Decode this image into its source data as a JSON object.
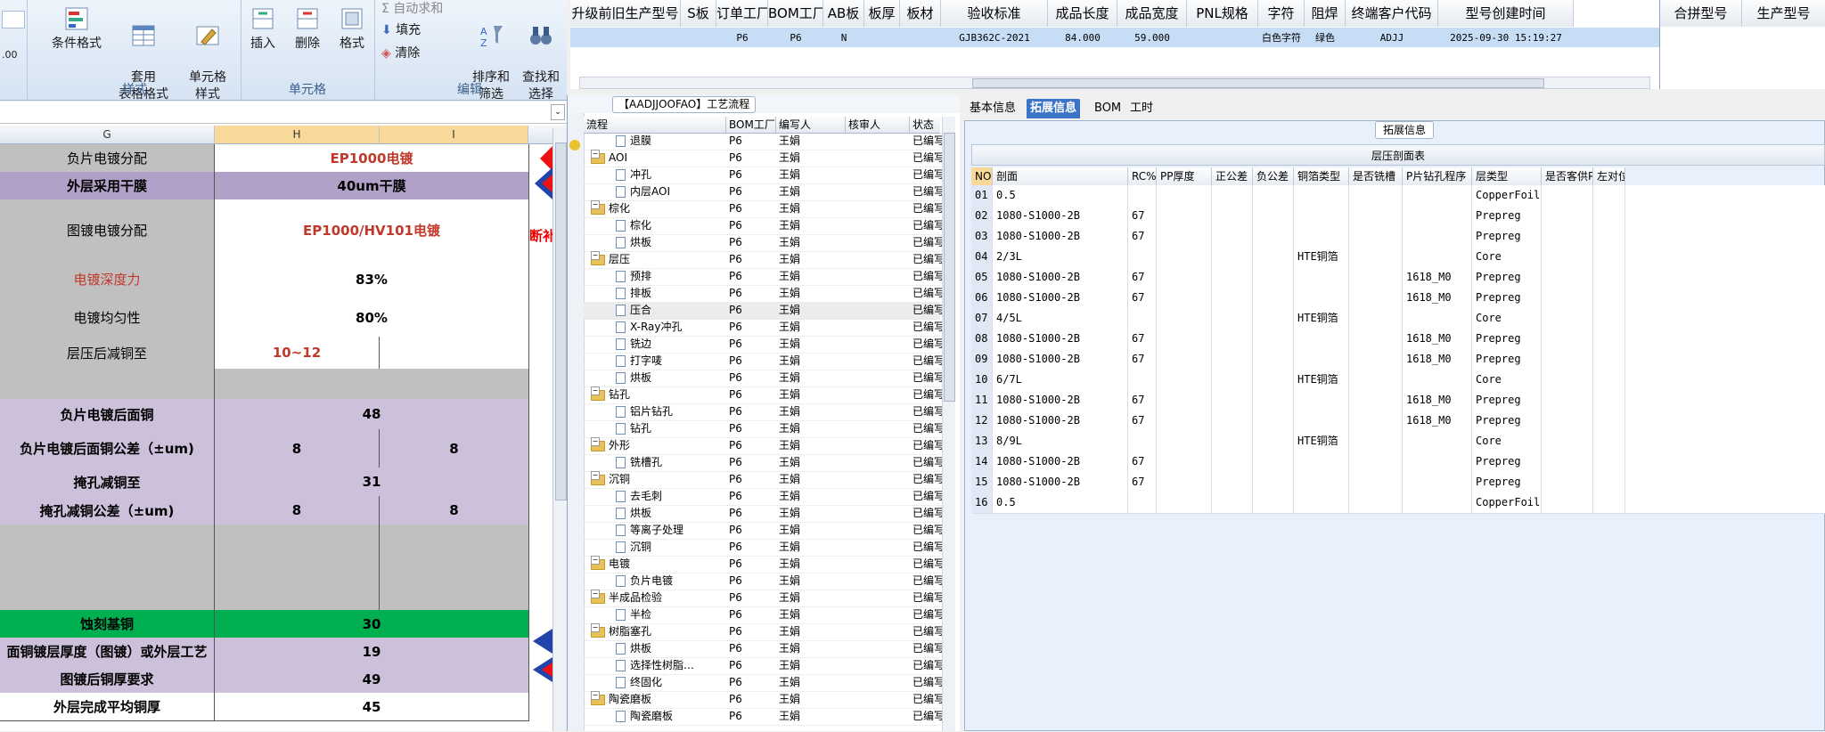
{
  "ribbon": {
    "groups": [
      {
        "label": "样式",
        "buttons": [
          "条件格式",
          "套用\n表格格式",
          "单元格\n样式"
        ]
      },
      {
        "label": "单元格",
        "buttons": [
          "插入",
          "删除",
          "格式"
        ]
      },
      {
        "label": "编辑",
        "small": [
          "Σ 自动求和",
          "填充",
          "清除"
        ],
        "buttons": [
          "排序和\n筛选",
          "查找和\n选择"
        ]
      }
    ]
  },
  "sheet": {
    "columns": [
      "G",
      "H",
      "I"
    ],
    "rows": [
      {
        "g": "负片电镀分配",
        "h": "EP1000电镀",
        "i": "",
        "merged": true,
        "style": "lav",
        "hred": true
      },
      {
        "g": "外层采用干膜",
        "h": "40um干膜",
        "i": "",
        "merged": true,
        "style": "purp"
      },
      {
        "g": "图镀电镀分配",
        "h": "EP1000/HV101电镀",
        "i": "",
        "merged": true,
        "style": "lav",
        "hred": true
      },
      {
        "g": "电镀深度力",
        "h": "83%",
        "i": "",
        "merged": true,
        "style": "lav",
        "gred": true
      },
      {
        "g": "电镀均匀性",
        "h": "80%",
        "i": "",
        "merged": true,
        "style": "lav"
      },
      {
        "g": "层压后减铜至",
        "h": "10~12",
        "i": "",
        "merged": false,
        "style": "lav",
        "hred": true
      },
      {
        "g": "",
        "h": "",
        "i": "",
        "merged": true,
        "style": "gry"
      },
      {
        "g": "负片电镀后面铜",
        "h": "48",
        "i": "",
        "merged": true,
        "style": "lav"
      },
      {
        "g": "负片电镀后面铜公差（±um)",
        "h": "8",
        "i": "8",
        "merged": false,
        "style": "lav"
      },
      {
        "g": "掩孔减铜至",
        "h": "31",
        "i": "",
        "merged": true,
        "style": "lav"
      },
      {
        "g": "掩孔减铜公差（±um)",
        "h": "8",
        "i": "8",
        "merged": false,
        "style": "lav"
      },
      {
        "g": "",
        "h": "",
        "i": "",
        "merged": false,
        "style": "gry"
      },
      {
        "g": "",
        "h": "",
        "i": "",
        "merged": false,
        "style": "gry"
      },
      {
        "g": "",
        "h": "",
        "i": "",
        "merged": false,
        "style": "gry"
      },
      {
        "g": "蚀刻基铜",
        "h": "30",
        "i": "",
        "merged": true,
        "style": "grn"
      },
      {
        "g": "面铜镀层厚度（图镀）或外层工艺",
        "h": "19",
        "i": "",
        "merged": true,
        "style": "lav"
      },
      {
        "g": "图镀后铜厚要求",
        "h": "49",
        "i": "",
        "merged": true,
        "style": "lav"
      },
      {
        "g": "外层完成平均铜厚",
        "h": "45",
        "i": "",
        "merged": true,
        "style": "wht"
      }
    ],
    "side_note": "断补"
  },
  "top_grid": {
    "headers": [
      "升级前旧生产型号",
      "S板",
      "订单工厂",
      "BOM工厂",
      "AB板",
      "板厚",
      "板材",
      "验收标准",
      "成品长度",
      "成品宽度",
      "PNL规格",
      "字符",
      "阻焊",
      "终端客户代码",
      "型号创建时间"
    ],
    "row": [
      "",
      "",
      "P6",
      "P6",
      "N",
      "",
      "",
      "GJB362C-2021",
      "84.000",
      "59.000",
      "",
      "白色字符",
      "绿色",
      "ADJJ",
      "2025-09-30 15:19:27"
    ],
    "right_headers": [
      "合拼型号",
      "生产型号"
    ]
  },
  "tree": {
    "title": "【AADJJOOFAO】工艺流程",
    "headers": [
      "流程",
      "BOM工厂",
      "编写人",
      "核审人",
      "状态"
    ],
    "rows": [
      {
        "level": 2,
        "name": "退膜",
        "factory": "P6",
        "author": "王娟",
        "status": "已编写"
      },
      {
        "level": 1,
        "name": "AOI",
        "factory": "P6",
        "author": "王娟",
        "status": "已编写"
      },
      {
        "level": 2,
        "name": "冲孔",
        "factory": "P6",
        "author": "王娟",
        "status": "已编写"
      },
      {
        "level": 2,
        "name": "内层AOI",
        "factory": "P6",
        "author": "王娟",
        "status": "已编写"
      },
      {
        "level": 1,
        "name": "棕化",
        "factory": "P6",
        "author": "王娟",
        "status": "已编写"
      },
      {
        "level": 2,
        "name": "棕化",
        "factory": "P6",
        "author": "王娟",
        "status": "已编写"
      },
      {
        "level": 2,
        "name": "烘板",
        "factory": "P6",
        "author": "王娟",
        "status": "已编写"
      },
      {
        "level": 1,
        "name": "层压",
        "factory": "P6",
        "author": "王娟",
        "status": "已编写"
      },
      {
        "level": 2,
        "name": "预排",
        "factory": "P6",
        "author": "王娟",
        "status": "已编写"
      },
      {
        "level": 2,
        "name": "排板",
        "factory": "P6",
        "author": "王娟",
        "status": "已编写"
      },
      {
        "level": 2,
        "name": "压合",
        "factory": "P6",
        "author": "王娟",
        "status": "已编写"
      },
      {
        "level": 2,
        "name": "X-Ray冲孔",
        "factory": "P6",
        "author": "王娟",
        "status": "已编写"
      },
      {
        "level": 2,
        "name": "铣边",
        "factory": "P6",
        "author": "王娟",
        "status": "已编写"
      },
      {
        "level": 2,
        "name": "打字唛",
        "factory": "P6",
        "author": "王娟",
        "status": "已编写"
      },
      {
        "level": 2,
        "name": "烘板",
        "factory": "P6",
        "author": "王娟",
        "status": "已编写"
      },
      {
        "level": 1,
        "name": "钻孔",
        "factory": "P6",
        "author": "王娟",
        "status": "已编写"
      },
      {
        "level": 2,
        "name": "铝片钻孔",
        "factory": "P6",
        "author": "王娟",
        "status": "已编写"
      },
      {
        "level": 2,
        "name": "钻孔",
        "factory": "P6",
        "author": "王娟",
        "status": "已编写"
      },
      {
        "level": 1,
        "name": "外形",
        "factory": "P6",
        "author": "王娟",
        "status": "已编写"
      },
      {
        "level": 2,
        "name": "铣槽孔",
        "factory": "P6",
        "author": "王娟",
        "status": "已编写"
      },
      {
        "level": 1,
        "name": "沉铜",
        "factory": "P6",
        "author": "王娟",
        "status": "已编写"
      },
      {
        "level": 2,
        "name": "去毛刺",
        "factory": "P6",
        "author": "王娟",
        "status": "已编写"
      },
      {
        "level": 2,
        "name": "烘板",
        "factory": "P6",
        "author": "王娟",
        "status": "已编写"
      },
      {
        "level": 2,
        "name": "等离子处理",
        "factory": "P6",
        "author": "王娟",
        "status": "已编写"
      },
      {
        "level": 2,
        "name": "沉铜",
        "factory": "P6",
        "author": "王娟",
        "status": "已编写"
      },
      {
        "level": 1,
        "name": "电镀",
        "factory": "P6",
        "author": "王娟",
        "status": "已编写"
      },
      {
        "level": 2,
        "name": "负片电镀",
        "factory": "P6",
        "author": "王娟",
        "status": "已编写"
      },
      {
        "level": 1,
        "name": "半成品检验",
        "factory": "P6",
        "author": "王娟",
        "status": "已编写"
      },
      {
        "level": 2,
        "name": "半检",
        "factory": "P6",
        "author": "王娟",
        "status": "已编写"
      },
      {
        "level": 1,
        "name": "树脂塞孔",
        "factory": "P6",
        "author": "王娟",
        "status": "已编写"
      },
      {
        "level": 2,
        "name": "烘板",
        "factory": "P6",
        "author": "王娟",
        "status": "已编写"
      },
      {
        "level": 2,
        "name": "选择性树脂…",
        "factory": "P6",
        "author": "王娟",
        "status": "已编写"
      },
      {
        "level": 2,
        "name": "终固化",
        "factory": "P6",
        "author": "王娟",
        "status": "已编写"
      },
      {
        "level": 1,
        "name": "陶瓷磨板",
        "factory": "P6",
        "author": "王娟",
        "status": "已编写"
      },
      {
        "level": 2,
        "name": "陶瓷磨板",
        "factory": "P6",
        "author": "王娟",
        "status": "已编写"
      }
    ]
  },
  "detail": {
    "tabs": [
      "基本信息",
      "拓展信息",
      "BOM",
      "工时"
    ],
    "active_tab": "拓展信息",
    "panel_title": "拓展信息",
    "table_title": "层压剖面表",
    "headers": [
      "NO",
      "剖面",
      "RC%",
      "PP厚度",
      "正公差",
      "负公差",
      "铜箔类型",
      "是否铣槽",
      "P片钻孔程序",
      "层类型",
      "是否客供PP",
      "左对位"
    ],
    "rows": [
      [
        "01",
        "0.5",
        "",
        "",
        "",
        "",
        "",
        "",
        "",
        "CopperFoil"
      ],
      [
        "02",
        "1080-S1000-2B",
        "67",
        "",
        "",
        "",
        "",
        "",
        "",
        "Prepreg"
      ],
      [
        "03",
        "1080-S1000-2B",
        "67",
        "",
        "",
        "",
        "",
        "",
        "",
        "Prepreg"
      ],
      [
        "04",
        "2/3L",
        "",
        "",
        "",
        "",
        "HTE铜箔",
        "",
        "",
        "Core"
      ],
      [
        "05",
        "1080-S1000-2B",
        "67",
        "",
        "",
        "",
        "",
        "",
        "1618_M0",
        "Prepreg"
      ],
      [
        "06",
        "1080-S1000-2B",
        "67",
        "",
        "",
        "",
        "",
        "",
        "1618_M0",
        "Prepreg"
      ],
      [
        "07",
        "4/5L",
        "",
        "",
        "",
        "",
        "HTE铜箔",
        "",
        "",
        "Core"
      ],
      [
        "08",
        "1080-S1000-2B",
        "67",
        "",
        "",
        "",
        "",
        "",
        "1618_M0",
        "Prepreg"
      ],
      [
        "09",
        "1080-S1000-2B",
        "67",
        "",
        "",
        "",
        "",
        "",
        "1618_M0",
        "Prepreg"
      ],
      [
        "10",
        "6/7L",
        "",
        "",
        "",
        "",
        "HTE铜箔",
        "",
        "",
        "Core"
      ],
      [
        "11",
        "1080-S1000-2B",
        "67",
        "",
        "",
        "",
        "",
        "",
        "1618_M0",
        "Prepreg"
      ],
      [
        "12",
        "1080-S1000-2B",
        "67",
        "",
        "",
        "",
        "",
        "",
        "1618_M0",
        "Prepreg"
      ],
      [
        "13",
        "8/9L",
        "",
        "",
        "",
        "",
        "HTE铜箔",
        "",
        "",
        "Core"
      ],
      [
        "14",
        "1080-S1000-2B",
        "67",
        "",
        "",
        "",
        "",
        "",
        "",
        "Prepreg"
      ],
      [
        "15",
        "1080-S1000-2B",
        "67",
        "",
        "",
        "",
        "",
        "",
        "",
        "Prepreg"
      ],
      [
        "16",
        "0.5",
        "",
        "",
        "",
        "",
        "",
        "",
        "",
        "CopperFoil"
      ]
    ]
  }
}
